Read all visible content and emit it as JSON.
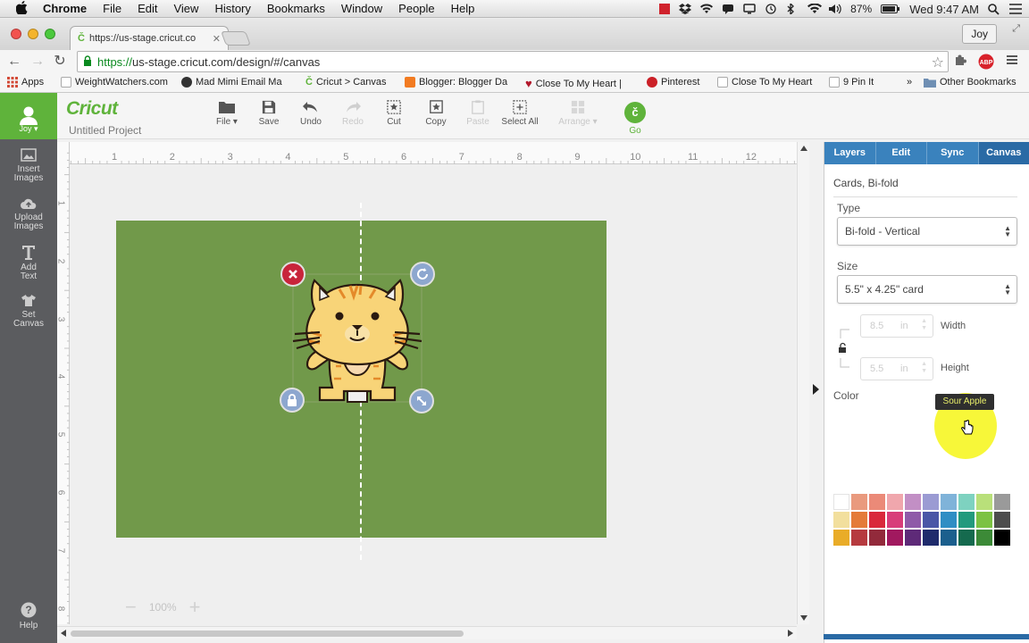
{
  "menubar": {
    "app": "Chrome",
    "items": [
      "File",
      "Edit",
      "View",
      "History",
      "Bookmarks",
      "Window",
      "People",
      "Help"
    ],
    "battery": "87%",
    "clock": "Wed 9:47 AM"
  },
  "browser": {
    "tab_title": "https://us-stage.cricut.co",
    "profile": "Joy",
    "url_scheme": "https://",
    "url_rest": "us-stage.cricut.com/design/#/canvas",
    "bookmarks": [
      "Apps",
      "WeightWatchers.com",
      "Mad Mimi Email Ma",
      "Cricut > Canvas",
      "Blogger: Blogger Da",
      "Close To My Heart |",
      "Pinterest",
      "Close To My Heart",
      "9 Pin It",
      "Other Bookmarks"
    ],
    "bookmarks_more": "»"
  },
  "app": {
    "user": "Joy",
    "logo": "Cricut",
    "project_name": "Untitled Project",
    "nav": [
      {
        "line1": "Insert",
        "line2": "Images"
      },
      {
        "line1": "Upload",
        "line2": "Images"
      },
      {
        "line1": "Add",
        "line2": "Text"
      },
      {
        "line1": "Set",
        "line2": "Canvas"
      }
    ],
    "help": "Help",
    "toolbar": {
      "file": "File",
      "save": "Save",
      "undo": "Undo",
      "redo": "Redo",
      "cut": "Cut",
      "copy": "Copy",
      "paste": "Paste",
      "select_all": "Select All",
      "arrange": "Arrange",
      "go": "Go",
      "go_glyph": "č"
    },
    "ruler_h": [
      "1",
      "2",
      "3",
      "4",
      "5",
      "6",
      "7",
      "8",
      "9",
      "10",
      "11",
      "12"
    ],
    "ruler_v": [
      "1",
      "2",
      "3",
      "4",
      "5",
      "6",
      "7",
      "8"
    ],
    "zoom": "100%",
    "canvas_color": "#71994a"
  },
  "panel": {
    "tabs": [
      "Layers",
      "Edit",
      "Sync",
      "Canvas"
    ],
    "active_tab": "Canvas",
    "heading": "Cards, Bi-fold",
    "type_label": "Type",
    "type_value": "Bi-fold - Vertical",
    "size_label": "Size",
    "size_value": "5.5\" x 4.25\" card",
    "width_value": "8.5",
    "height_value": "5.5",
    "unit": "in",
    "width_label": "Width",
    "height_label": "Height",
    "color_label": "Color",
    "tooltip": "Sour Apple",
    "swatches": [
      "#ffffff",
      "#e99a7e",
      "#eb8a78",
      "#f0a7ad",
      "#c28fc5",
      "#9b9bd3",
      "#7fb3d9",
      "#7ed2c0",
      "#b9e07a",
      "#9a9a9a",
      "#f2df9d",
      "#e47b39",
      "#d9283b",
      "#d83d7a",
      "#8f5aa8",
      "#4a56a6",
      "#2f8ec4",
      "#239a7d",
      "#7cc243",
      "#4d4d4d",
      "#e9ac28",
      "#b63a3f",
      "#922a3b",
      "#a1195f",
      "#5e2a78",
      "#1f2b6c",
      "#1b5f8d",
      "#156a4e",
      "#3c8a37",
      "#000000"
    ]
  }
}
